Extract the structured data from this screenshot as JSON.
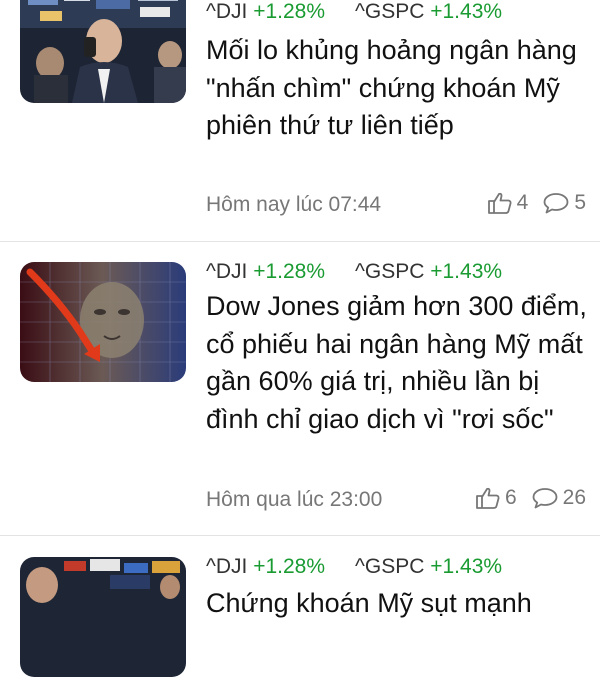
{
  "articles": [
    {
      "tickers": [
        {
          "symbol": "^DJI",
          "change": "+1.28%"
        },
        {
          "symbol": "^GSPC",
          "change": "+1.43%"
        }
      ],
      "title": "Mối lo khủng hoảng ngân hàng \"nhấn chìm\" chứng khoán Mỹ phiên thứ tư liên tiếp",
      "time": "Hôm nay lúc 07:44",
      "likes": "4",
      "comments": "5",
      "thumbnail_icon": "trader-photo"
    },
    {
      "tickers": [
        {
          "symbol": "^DJI",
          "change": "+1.28%"
        },
        {
          "symbol": "^GSPC",
          "change": "+1.43%"
        }
      ],
      "title": "Dow Jones giảm hơn 300 điểm, cổ phiếu hai ngân hàng Mỹ mất gần 60% giá trị, nhiều lần bị đình chỉ giao dịch vì \"rơi sốc\"",
      "time": "Hôm qua lúc 23:00",
      "likes": "6",
      "comments": "26",
      "thumbnail_icon": "falling-dollar-photo"
    },
    {
      "tickers": [
        {
          "symbol": "^DJI",
          "change": "+1.28%"
        },
        {
          "symbol": "^GSPC",
          "change": "+1.43%"
        }
      ],
      "title": "Chứng khoán Mỹ sụt mạnh",
      "thumbnail_icon": "trading-floor-photo"
    }
  ],
  "colors": {
    "positive": "#1a9b32",
    "meta": "#777777",
    "separator": "#e3e3e3"
  }
}
